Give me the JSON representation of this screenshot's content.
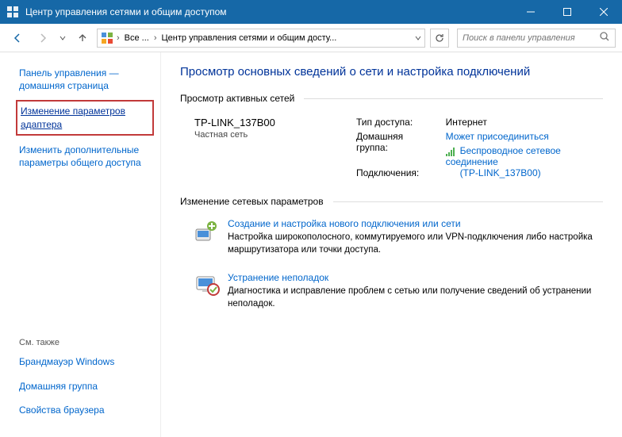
{
  "titlebar": {
    "title": "Центр управления сетями и общим доступом"
  },
  "breadcrumb": {
    "seg1": "Все ...",
    "seg2": "Центр управления сетями и общим досту..."
  },
  "search": {
    "placeholder": "Поиск в панели управления"
  },
  "sidebar": {
    "home": "Панель управления — домашняя страница",
    "adapter_link": "Изменение параметров адаптера",
    "advanced": "Изменить дополнительные параметры общего доступа",
    "see_also_hdr": "См. также",
    "see_also": {
      "firewall": "Брандмауэр Windows",
      "homegroup": "Домашняя группа",
      "browser": "Свойства браузера"
    }
  },
  "main": {
    "title": "Просмотр основных сведений о сети и настройка подключений",
    "active_networks_hdr": "Просмотр активных сетей",
    "network": {
      "name": "TP-LINK_137B00",
      "type": "Частная сеть",
      "labels": {
        "access": "Тип доступа:",
        "homegroup": "Домашняя группа:",
        "connections": "Подключения:"
      },
      "values": {
        "access": "Интернет",
        "homegroup": "Может присоединиться",
        "conn_line1": "Беспроводное сетевое соединение",
        "conn_line2": "(TP-LINK_137B00)"
      }
    },
    "change_hdr": "Изменение сетевых параметров",
    "task1": {
      "title": "Создание и настройка нового подключения или сети",
      "desc": "Настройка широкополосного, коммутируемого или VPN-подключения либо настройка маршрутизатора или точки доступа."
    },
    "task2": {
      "title": "Устранение неполадок",
      "desc": "Диагностика и исправление проблем с сетью или получение сведений об устранении неполадок."
    }
  }
}
